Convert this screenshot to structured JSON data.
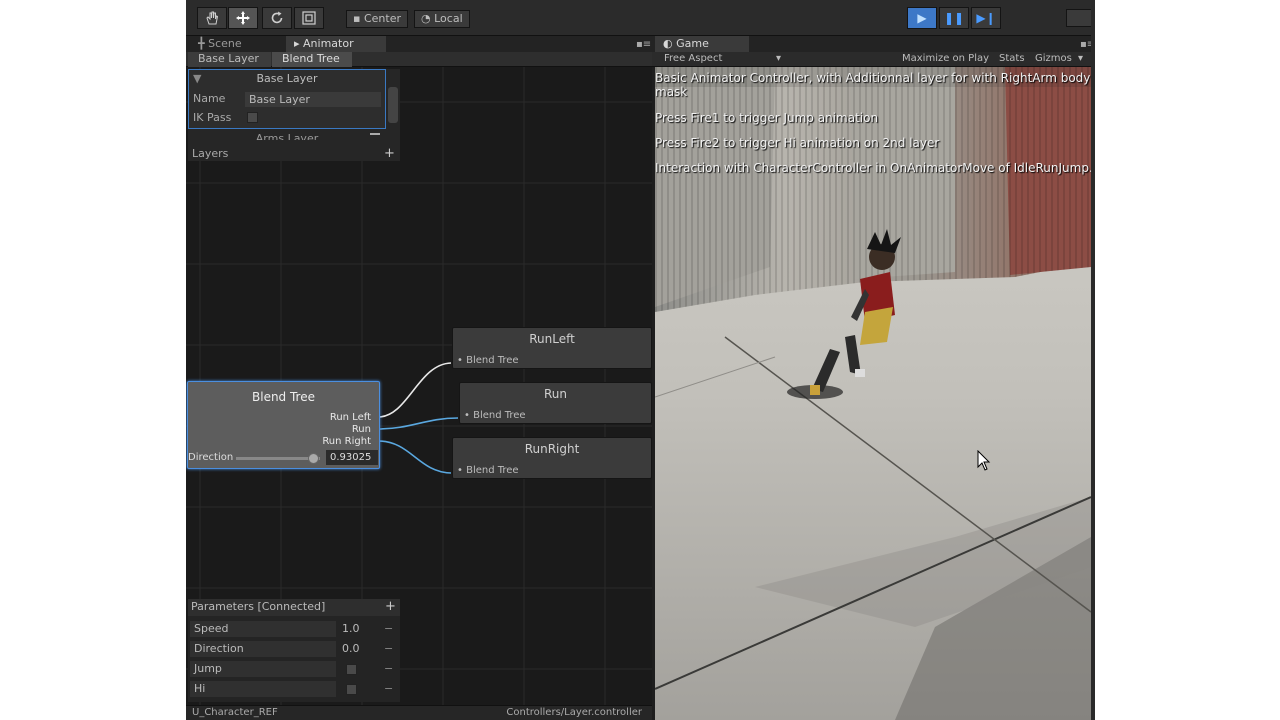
{
  "toolbar": {
    "tools": [
      "hand-icon",
      "move-icon",
      "rotate-icon",
      "scale-icon"
    ],
    "pivot_mode": "Center",
    "pivot_rotation": "Local",
    "pivot_mode_icon": "▪",
    "pivot_rotation_icon": "◔"
  },
  "tabs": {
    "scene": "Scene",
    "animator": "Animator",
    "game": "Game",
    "scene_icon": "╋",
    "animator_icon": "▸",
    "game_icon": "◐"
  },
  "animator": {
    "breadcrumb": [
      "Base Layer",
      "Blend Tree"
    ],
    "layers": {
      "base_layer_title": "Base Layer",
      "name_label": "Name",
      "name_value": "Base Layer",
      "ik_pass_label": "IK Pass",
      "arms_layer_title": "Arms Layer",
      "layers_label": "Layers"
    },
    "blend_node": {
      "title": "Blend Tree",
      "outputs": [
        "Run Left",
        "Run",
        "Run Right"
      ],
      "param_label": "Direction",
      "param_value": "0.93025",
      "param_fraction": 0.93
    },
    "motion_nodes": [
      {
        "title": "RunLeft",
        "port": "Blend Tree"
      },
      {
        "title": "Run",
        "port": "Blend Tree"
      },
      {
        "title": "RunRight",
        "port": "Blend Tree"
      }
    ],
    "parameters": {
      "header": "Parameters [Connected]",
      "items": [
        {
          "name": "Speed",
          "value": "1.0"
        },
        {
          "name": "Direction",
          "value": "0.0"
        },
        {
          "name": "Jump",
          "value": ""
        },
        {
          "name": "Hi",
          "value": ""
        }
      ]
    },
    "status_left": "U_Character_REF",
    "status_right": "Controllers/Layer.controller"
  },
  "game": {
    "aspect": "Free Aspect",
    "maximize": "Maximize on Play",
    "stats": "Stats",
    "gizmos": "Gizmos",
    "messages": [
      "Basic Animator Controller, with Additionnal layer for with RightArm body",
      "mask",
      "Press Fire1 to trigger Jump animation",
      "Press Fire2 to trigger Hi animation on 2nd layer",
      "Interaction with CharacterController in OnAnimatorMove of IdleRunJump.cs"
    ]
  },
  "colors": {
    "accent": "#3d78c7",
    "selection": "#4b8fe0",
    "panel": "#1a1a1a"
  }
}
